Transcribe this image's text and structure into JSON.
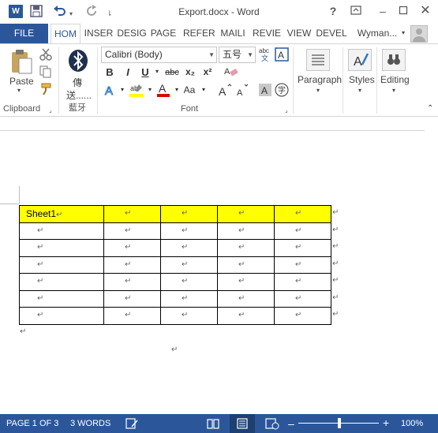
{
  "title_bar": {
    "title": "Export.docx - Word",
    "app_icon_letter": "W",
    "help": "?"
  },
  "tabs": [
    "FILE",
    "HOM",
    "INSER",
    "DESIG",
    "PAGE",
    "REFER",
    "MAILI",
    "REVIE",
    "VIEW",
    "DEVEL"
  ],
  "user": "Wyman...",
  "ribbon": {
    "clipboard": {
      "paste_label": "Paste",
      "group_label": "Clipboard"
    },
    "bluetooth": {
      "label_line1": "傳",
      "label_line2": "送......",
      "group_label": "藍牙"
    },
    "font": {
      "font_name": "Calibri (Body)",
      "font_size": "五号",
      "bold": "B",
      "italic": "I",
      "underline": "U",
      "strike": "abc",
      "subscript": "x₂",
      "superscript": "x²",
      "change_case": "Aa",
      "group_label": "Font"
    },
    "paragraph_label": "Paragraph",
    "styles_label": "Styles",
    "editing_label": "Editing"
  },
  "document": {
    "table_header_first": "Sheet1",
    "paragraph_mark": "↵",
    "rows": 7,
    "cols": 5
  },
  "status_bar": {
    "page": "PAGE 1 OF 3",
    "words": "3 WORDS",
    "zoom": "100%"
  },
  "colors": {
    "brand": "#2b579a",
    "table_header_fill": "#ffff00"
  }
}
